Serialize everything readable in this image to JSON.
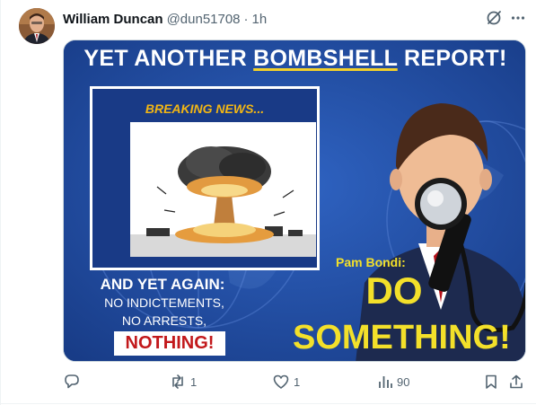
{
  "post": {
    "author_name": "William Duncan",
    "handle": "@dun51708",
    "separator": "·",
    "time": "1h",
    "grok_icon": "grok-icon",
    "more_icon": "more-horizontal-icon"
  },
  "media": {
    "headline_pre": "YET ANOTHER ",
    "headline_underlined": "BOMBSHELL",
    "headline_post": " REPORT!",
    "breaking": "BREAKING NEWS...",
    "and_yet": "AND YET AGAIN:",
    "no_indictements": "NO INDICTEMENTS,",
    "no_arrests": "NO ARRESTS,",
    "nothing": "NOTHING!",
    "pam": "Pam Bondi:",
    "do": "DO",
    "something": "SOMETHING!",
    "colors": {
      "background": "#1d4aa0",
      "headline": "#ffffff",
      "accent_yellow": "#f3e02a",
      "nothing_red": "#c2181b",
      "breaking_orange": "#f2b614"
    }
  },
  "actions": {
    "reply": {
      "icon": "reply-icon",
      "count": ""
    },
    "repost": {
      "icon": "repost-icon",
      "count": "1"
    },
    "like": {
      "icon": "heart-icon",
      "count": "1"
    },
    "views": {
      "icon": "views-icon",
      "count": "90"
    },
    "bookmark": {
      "icon": "bookmark-icon"
    },
    "share": {
      "icon": "share-icon"
    }
  }
}
